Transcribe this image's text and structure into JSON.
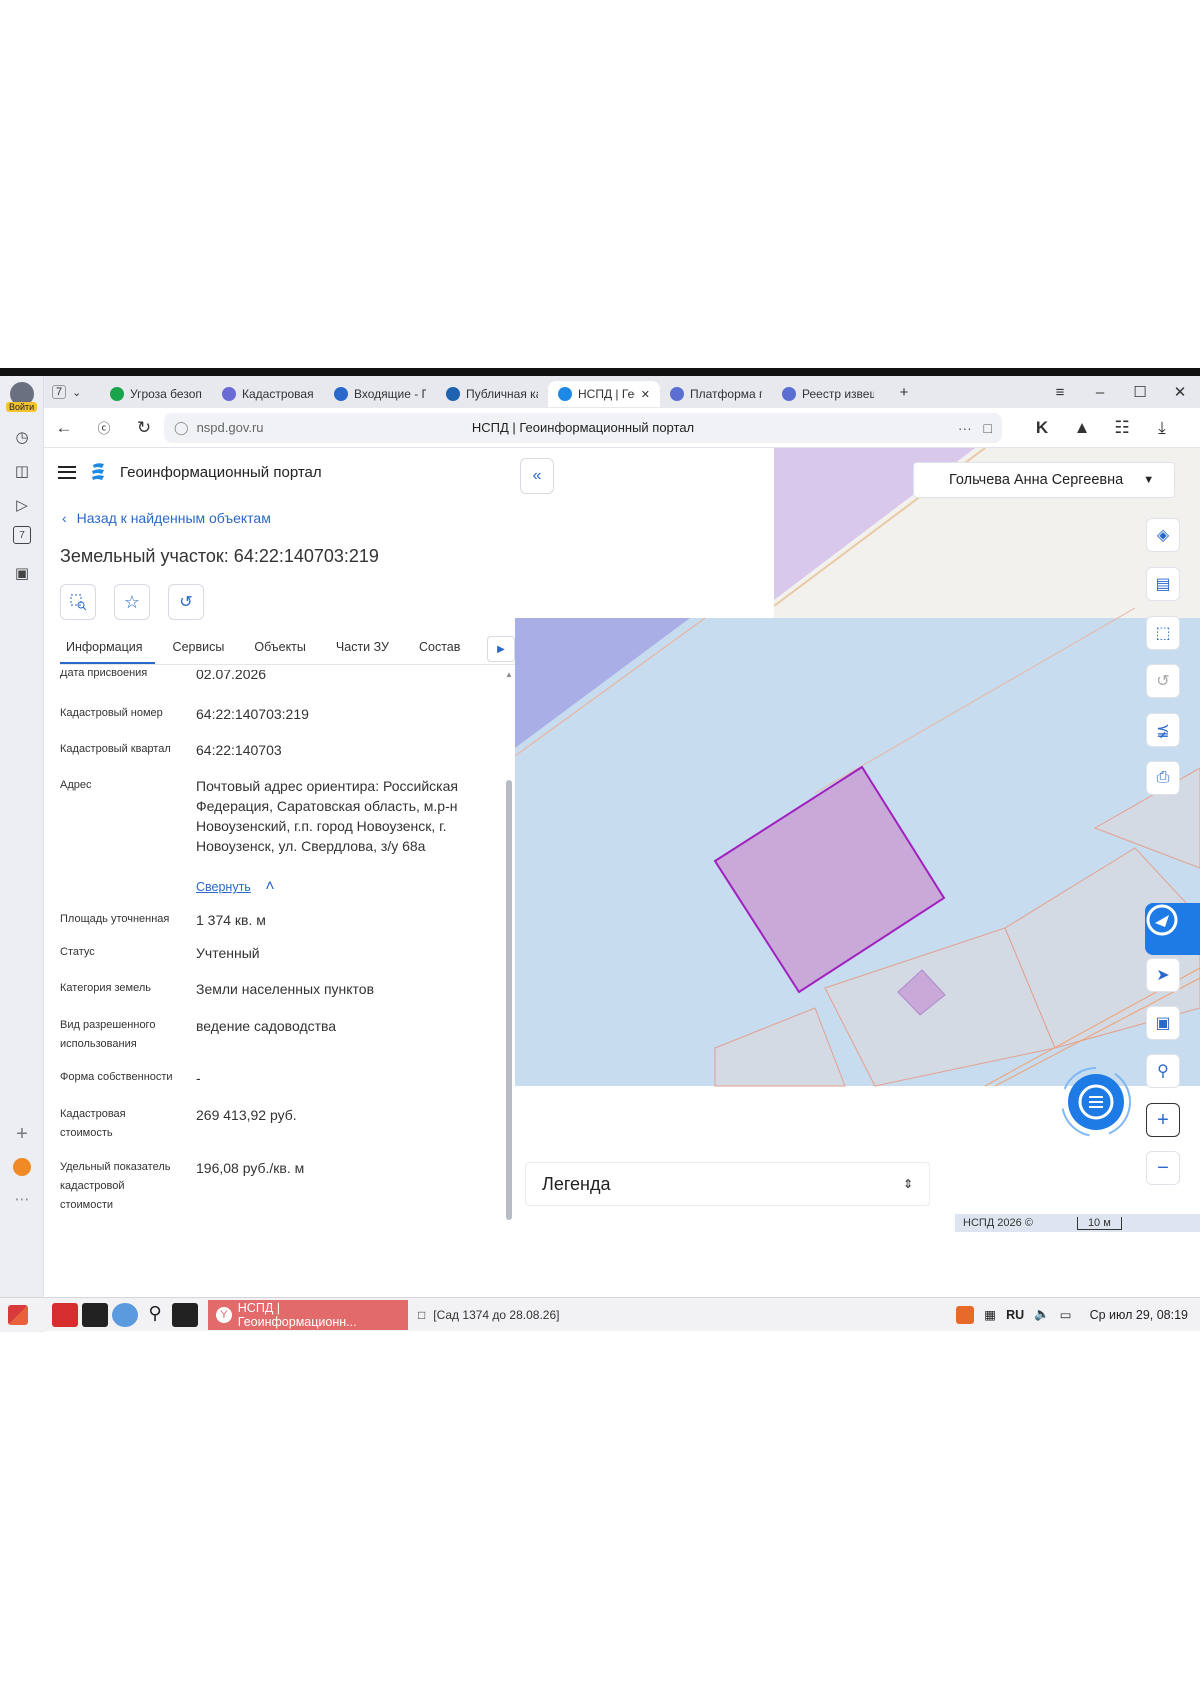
{
  "browser": {
    "sidebar": {
      "login_badge": "Войти",
      "today_number": "7"
    },
    "tab_count": "7",
    "tabs": [
      {
        "label": "Угроза безопа",
        "color": "#19a34a"
      },
      {
        "label": "Кадастровая к",
        "color": "#6b6bd6"
      },
      {
        "label": "Входящие - По",
        "color": "#2a69c9"
      },
      {
        "label": "Публичная кад",
        "color": "#1e62b0"
      },
      {
        "label": "НСПД | Геои",
        "color": "#1e88e5",
        "active": true
      },
      {
        "label": "Платформа го",
        "color": "#5a6fd1"
      },
      {
        "label": "Реестр извещ",
        "color": "#5a6fd1"
      }
    ],
    "new_tab": "+",
    "url_host": "nspd.gov.ru",
    "page_title": "НСПД | Геоинформационный портал",
    "url_more": "···"
  },
  "portal": {
    "title": "Геоинформационный портал",
    "back_link": "Назад к найденным объектам",
    "object_title": "Земельный участок: 64:22:140703:219",
    "tabs": [
      "Информация",
      "Сервисы",
      "Объекты",
      "Части ЗУ",
      "Состав"
    ],
    "collapse_label": "Свернуть",
    "fields": [
      {
        "label": "Дата присвоения",
        "value": "02.07.2026"
      },
      {
        "label": "Кадастровый номер",
        "value": "64:22:140703:219"
      },
      {
        "label": "Кадастровый квартал",
        "value": "64:22:140703"
      },
      {
        "label": "Адрес",
        "value": "Почтовый адрес ориентира: Российская Федерация, Саратовская область, м.р-н Новоузенский, г.п. город Новоузенск, г. Новоузенск, ул. Свердлова, з/у 68а"
      },
      {
        "label": "Площадь уточненная",
        "value": "1 374 кв. м"
      },
      {
        "label": "Статус",
        "value": "Учтенный"
      },
      {
        "label": "Категория земель",
        "value": "Земли населенных пунктов"
      },
      {
        "label": "Вид разрешенного использования",
        "value": "ведение садоводства"
      },
      {
        "label": "Форма собственности",
        "value": "-"
      },
      {
        "label": "Кадастровая стоимость",
        "value": "269 413,92 руб."
      },
      {
        "label": "Удельный показатель кадастровой стоимости",
        "value": "196,08 руб./кв. м"
      }
    ]
  },
  "map": {
    "user_name": "Гольчева Анна Сергеевна",
    "legend_label": "Легенда",
    "copyright": "НСПД 2026 ©",
    "scale": "10 м",
    "colors": {
      "zone_purple": "#d8c8ec",
      "zone_blue": "#c8dcef",
      "zone_violet": "#a9aee6",
      "parcel_fill": "#c8a9d8",
      "parcel_stroke": "#a020c0"
    }
  },
  "taskbar": {
    "active_window": "НСПД | Геоинформационн...",
    "reminder": "[Сад 1374 до 28.08.26]",
    "lang": "RU",
    "clock": "Ср июл 29, 08:19"
  }
}
